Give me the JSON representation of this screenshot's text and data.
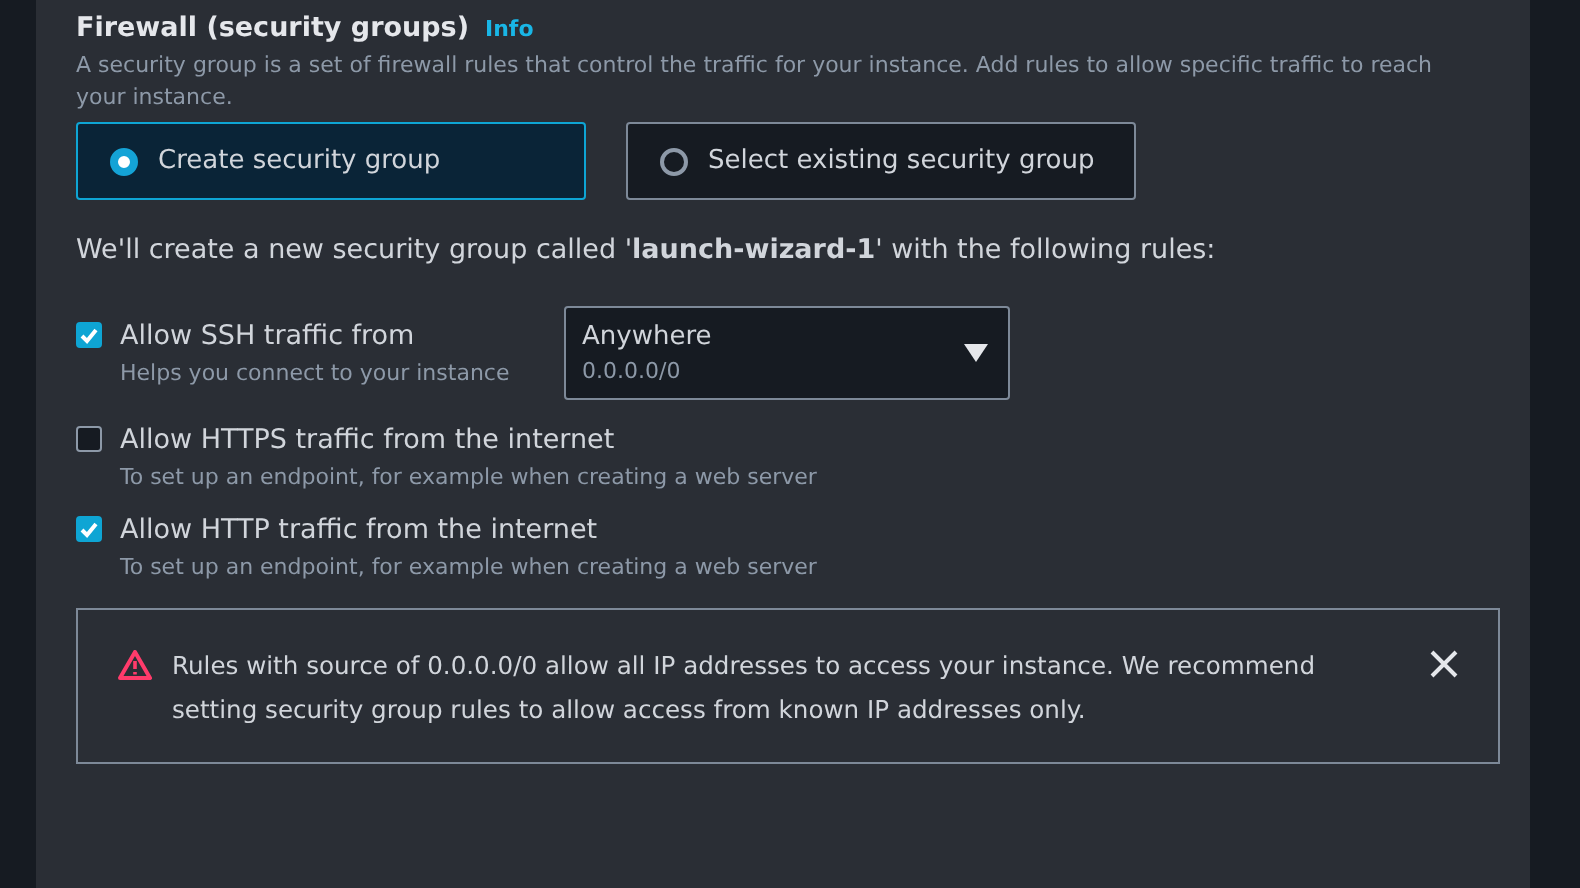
{
  "section": {
    "title": "Firewall (security groups)",
    "info_link": "Info",
    "description": "A security group is a set of firewall rules that control the traffic for your instance. Add rules to allow specific traffic to reach your instance."
  },
  "options": [
    {
      "label": "Create security group",
      "selected": true
    },
    {
      "label": "Select existing security group",
      "selected": false
    }
  ],
  "summary": "We'll create a new security group called '**launch-wizard-1**' with the following rules:",
  "rules": [
    {
      "label": "Allow SSH traffic from",
      "hint": "Helps you connect to your instance",
      "checked": true,
      "source": {
        "value": "Anywhere",
        "detail": "0.0.0.0/0"
      }
    },
    {
      "label": "Allow HTTPS traffic from the internet",
      "hint": "To set up an endpoint, for example when creating a web server",
      "checked": false
    },
    {
      "label": "Allow HTTP traffic from the internet",
      "hint": "To set up an endpoint, for example when creating a web server",
      "checked": true
    }
  ],
  "alert": {
    "message": "Rules with source of 0.0.0.0/0 allow all IP addresses to access your instance. We recommend setting security group rules to allow access from known IP addresses only.",
    "dismissible": true
  }
}
